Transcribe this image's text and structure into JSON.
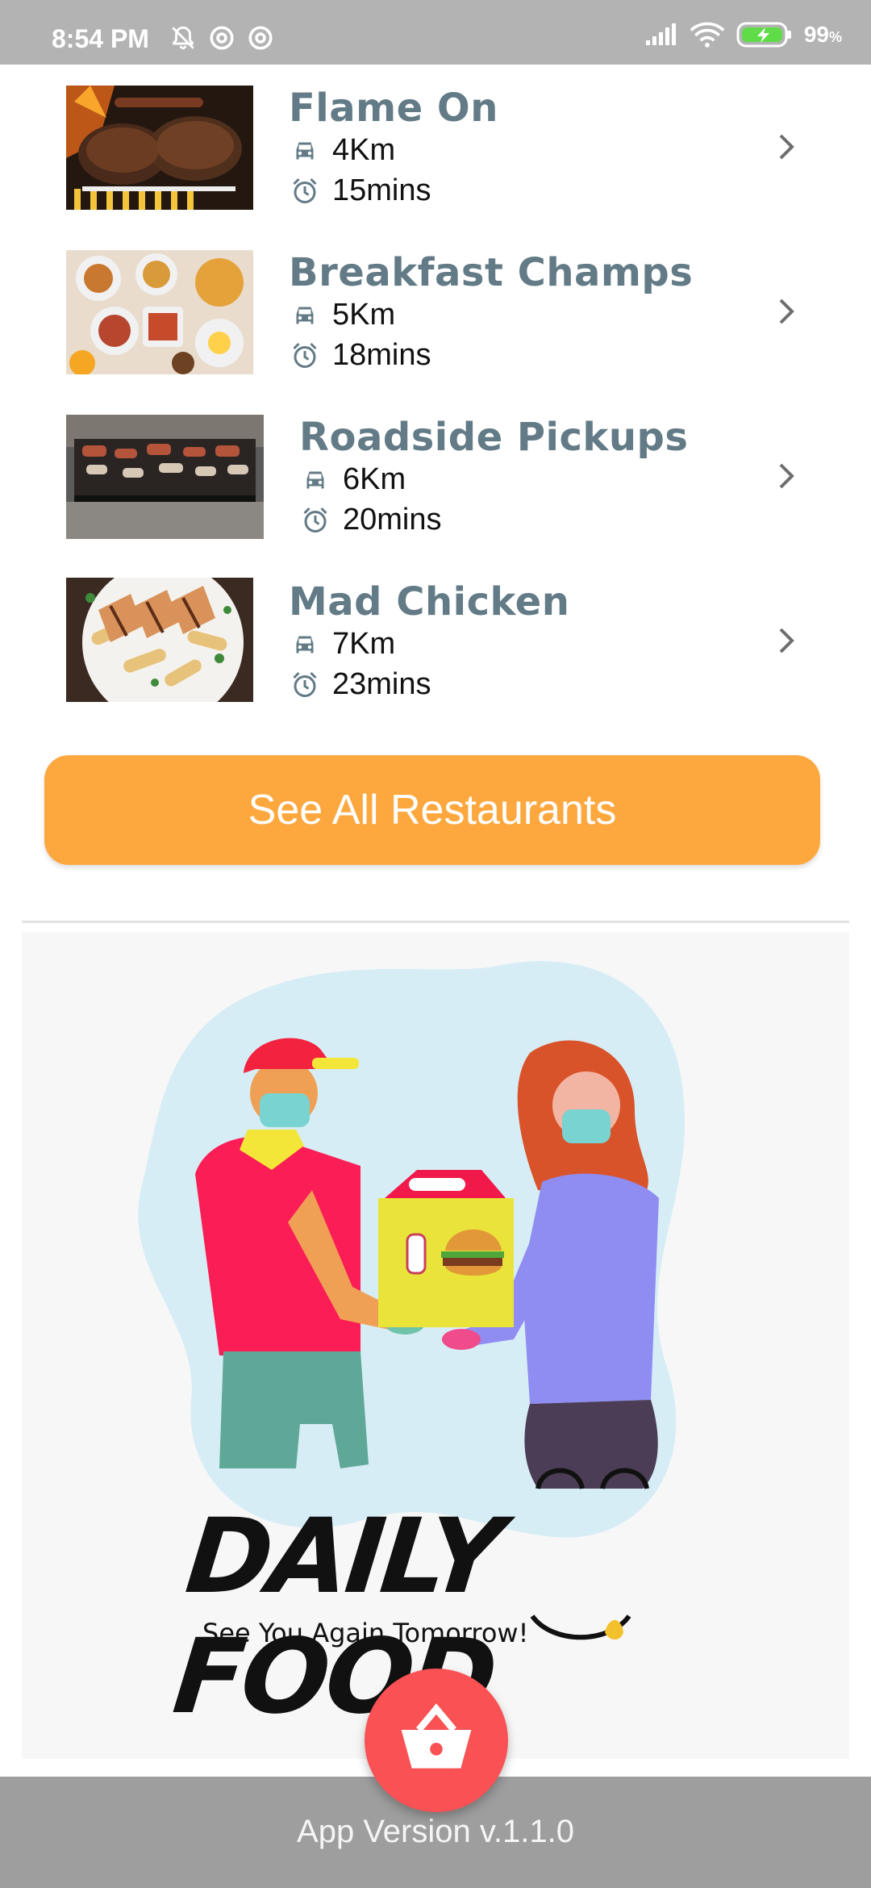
{
  "status_bar": {
    "time": "8:54 PM",
    "battery": "99",
    "battery_unit": "%"
  },
  "restaurants": [
    {
      "name": "Flame On",
      "distance": "4Km",
      "time": "15mins",
      "image": "grilled-burgers"
    },
    {
      "name": "Breakfast Champs",
      "distance": "5Km",
      "time": "18mins",
      "image": "breakfast-spread"
    },
    {
      "name": "Roadside Pickups",
      "distance": "6Km",
      "time": "20mins",
      "image": "barbecue-grill"
    },
    {
      "name": "Mad Chicken",
      "distance": "7Km",
      "time": "23mins",
      "image": "chicken-pasta"
    }
  ],
  "cta": {
    "label": "See All Restaurants"
  },
  "promo": {
    "brand": "DAILY FOOD",
    "tagline": "See You Again Tomorrow!"
  },
  "footer": {
    "app_version": "App Version v.1.1.0"
  },
  "icons": {
    "distance": "car-icon",
    "time": "alarm-clock-icon",
    "chevron": "chevron-right-icon",
    "cart": "shopping-basket-icon"
  },
  "colors": {
    "accent": "#fda83f",
    "restaurant_name": "#637b86",
    "fab": "#f95154",
    "footer": "#9e9e9e"
  }
}
